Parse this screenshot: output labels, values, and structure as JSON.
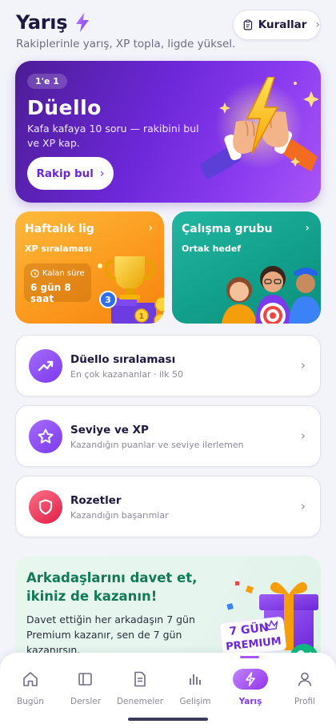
{
  "header": {
    "title": "Yarış",
    "subtitle": "Rakiplerinle yarış, XP topla, ligde yüksel.",
    "rules_label": "Kurallar"
  },
  "duel": {
    "badge": "1'e 1",
    "title": "Düello",
    "description": "Kafa kafaya 10 soru — rakibini bul ve XP kap.",
    "cta": "Rakip bul"
  },
  "league": {
    "title": "Haftalık lig",
    "subtitle": "XP sıralaması",
    "timer_label": "Kalan süre",
    "timer_value": "6 gün 8 saat"
  },
  "group": {
    "title": "Çalışma grubu",
    "subtitle": "Ortak hedef"
  },
  "list": [
    {
      "title": "Düello sıralaması",
      "subtitle": "En çok kazananlar · ilk 50",
      "icon": "trending-up-icon"
    },
    {
      "title": "Seviye ve XP",
      "subtitle": "Kazandığın puanlar ve seviye ilerlemen",
      "icon": "star-icon"
    },
    {
      "title": "Rozetler",
      "subtitle": "Kazandığın başarımlar",
      "icon": "shield-icon"
    }
  ],
  "invite": {
    "title": "Arkadaşlarını davet et, ikiniz de kazanın!",
    "description": "Davet ettiğin her arkadaşın 7 gün Premium kazanır, sen de 7 gün kazanırsın.",
    "gift_line1": "7 GÜN",
    "gift_line2": "PREMIUM"
  },
  "tabs": [
    {
      "label": "Bugün",
      "icon": "home-icon"
    },
    {
      "label": "Dersler",
      "icon": "book-icon"
    },
    {
      "label": "Denemeler",
      "icon": "document-icon"
    },
    {
      "label": "Gelişim",
      "icon": "bar-chart-icon"
    },
    {
      "label": "Yarış",
      "icon": "bolt-icon",
      "active": true
    },
    {
      "label": "Profil",
      "icon": "user-icon"
    }
  ],
  "colors": {
    "accent": "#7C3AED",
    "league": "#FB9A1E",
    "group": "#12A08B",
    "invite_title": "#117A58"
  }
}
